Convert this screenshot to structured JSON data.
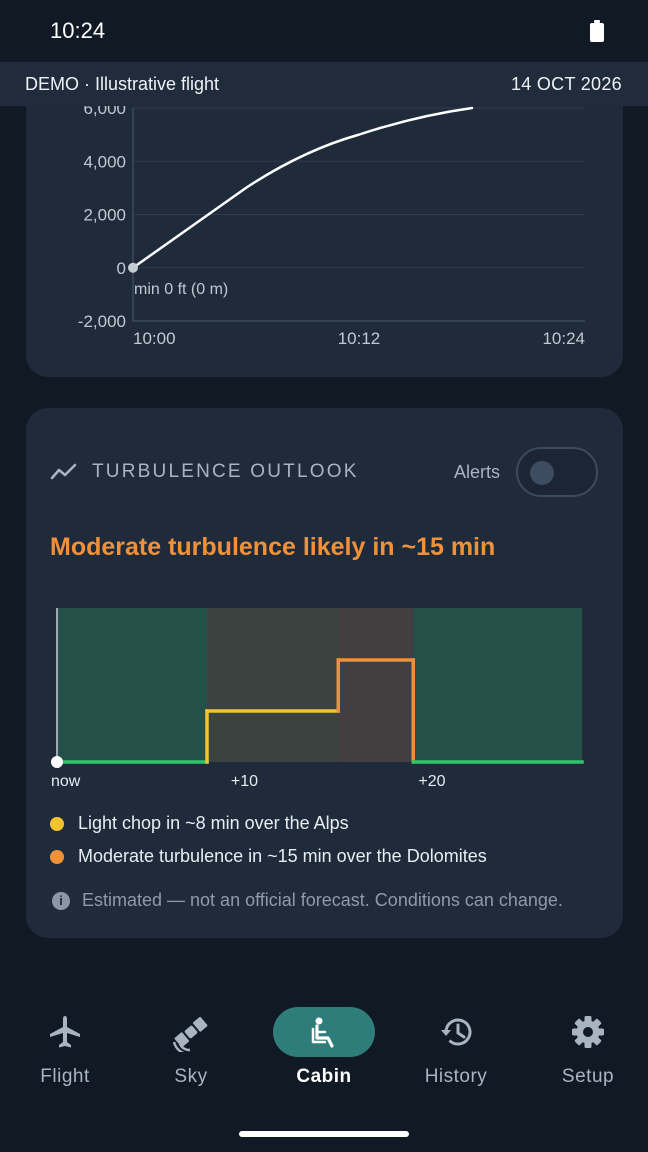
{
  "status_bar": {
    "time": "10:24"
  },
  "demo_banner": {
    "left": "DEMO · Illustrative flight",
    "right": "14 OCT 2026"
  },
  "altitude_chart": {
    "y_ticks": [
      "6,000",
      "4,000",
      "2,000",
      "0",
      "-2,000"
    ],
    "x_ticks": [
      "10:00",
      "10:12",
      "10:24"
    ],
    "min_label": "min 0 ft (0 m)",
    "line_color": "#ffffff"
  },
  "turbulence": {
    "title": "TURBULENCE OUTLOOK",
    "alerts_label": "Alerts",
    "alerts_on": false,
    "headline": "Moderate turbulence likely in ~15 min",
    "x_ticks": [
      "now",
      "+10",
      "+20"
    ],
    "legend": [
      {
        "text": "Light chop in ~8 min over the Alps",
        "color": "#f2c230"
      },
      {
        "text": "Moderate turbulence in ~15 min over the Dolomites",
        "color": "#f0913a"
      }
    ],
    "note": "Estimated — not an official forecast. Conditions can change.",
    "colors": {
      "calm": "#2fc46b",
      "light": "#f2c230",
      "moderate": "#f0913a"
    }
  },
  "chart_data": [
    {
      "type": "line",
      "x": [
        "10:00",
        "10:06",
        "10:12",
        "10:18"
      ],
      "y": [
        0,
        3000,
        5000,
        6000
      ],
      "ylim": [
        -2000,
        6000
      ],
      "x_ticks": [
        "10:00",
        "10:12",
        "10:24"
      ],
      "y_ticks": [
        -2000,
        0,
        2000,
        4000,
        6000
      ],
      "annotation": "min 0 ft (0 m)",
      "grid": true
    },
    {
      "type": "line",
      "x_ticks": [
        "now",
        "+10",
        "+20"
      ],
      "x": [
        0,
        8,
        8,
        15,
        15,
        19,
        19,
        28
      ],
      "y": [
        0,
        0,
        1,
        1,
        2,
        2,
        0,
        0
      ],
      "segments": [
        {
          "level": "calm",
          "from": 0,
          "to": 8
        },
        {
          "level": "light",
          "from": 8,
          "to": 15
        },
        {
          "level": "moderate",
          "from": 15,
          "to": 19
        },
        {
          "level": "calm",
          "from": 19,
          "to": 28
        }
      ]
    }
  ],
  "nav": {
    "items": [
      {
        "label": "Flight",
        "icon": "plane-icon",
        "active": false
      },
      {
        "label": "Sky",
        "icon": "satellite-icon",
        "active": false
      },
      {
        "label": "Cabin",
        "icon": "seat-icon",
        "active": true
      },
      {
        "label": "History",
        "icon": "history-icon",
        "active": false
      },
      {
        "label": "Setup",
        "icon": "gear-icon",
        "active": false
      }
    ]
  }
}
